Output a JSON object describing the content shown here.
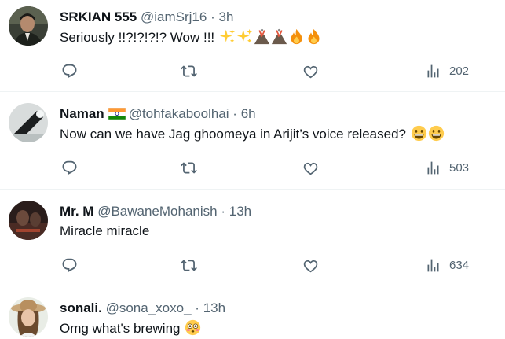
{
  "replies": [
    {
      "name": "SRKIAN 555",
      "handle": "@iamSrj16",
      "separator": "·",
      "time": "3h",
      "text": "Seriously !!?!?!?!? Wow !!! ",
      "emojis": [
        "sparkles-icon",
        "sparkles-icon",
        "volcano-icon",
        "volcano-icon",
        "fire-icon",
        "fire-icon"
      ],
      "views": "202",
      "avatar": "avatar-photo-man-suit"
    },
    {
      "name": "Naman",
      "flag": "india-flag-icon",
      "handle": "@tohfakaboolhai",
      "separator": "·",
      "time": "6h",
      "text": "Now can we have Jag ghoomeya in Arijit’s voice released? ",
      "emojis": [
        "grinning-face-icon",
        "grinning-face-icon"
      ],
      "views": "503",
      "avatar": "avatar-photo-dark-spotlight"
    },
    {
      "name": "Mr. M",
      "handle": "@BawaneMohanish",
      "separator": "·",
      "time": "13h",
      "text": "Miracle miracle",
      "emojis": [],
      "views": "634",
      "avatar": "avatar-photo-dim-scene"
    },
    {
      "name": "sonali.",
      "handle": "@sona_xoxo_",
      "separator": "·",
      "time": "13h",
      "text": "Omg what's brewing ",
      "emojis": [
        "flushed-face-icon"
      ],
      "avatar": "avatar-photo-woman-hat"
    }
  ],
  "colors": {
    "text_primary": "#0f1419",
    "text_secondary": "#536471",
    "divider": "#eff3f4"
  }
}
